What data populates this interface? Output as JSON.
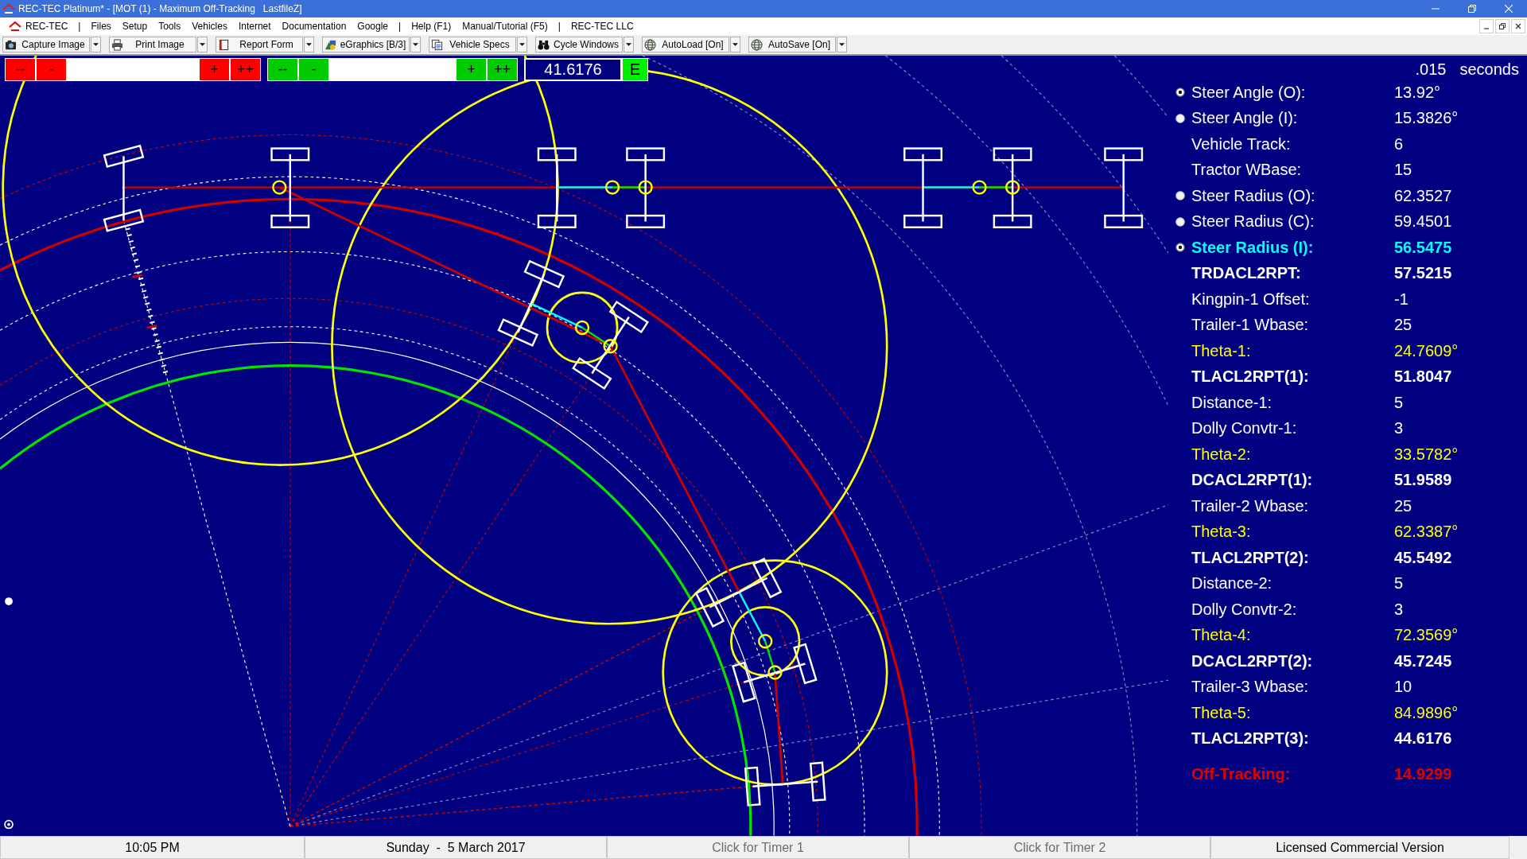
{
  "window": {
    "title": "REC-TEC Platinum* - [MOT (1) - Maximum Off-Tracking   LastfileZ]"
  },
  "menu": [
    {
      "label": "REC-TEC",
      "kind": "app"
    },
    {
      "label": "|",
      "kind": "separator"
    },
    {
      "label": "Files",
      "kind": "item"
    },
    {
      "label": "Setup",
      "kind": "item"
    },
    {
      "label": "Tools",
      "kind": "item"
    },
    {
      "label": "Vehicles",
      "kind": "item"
    },
    {
      "label": "Internet",
      "kind": "item"
    },
    {
      "label": "Documentation",
      "kind": "item"
    },
    {
      "label": "Google",
      "kind": "item"
    },
    {
      "label": "|",
      "kind": "separator"
    },
    {
      "label": "Help (F1)",
      "kind": "item"
    },
    {
      "label": "Manual/Tutorial (F5)",
      "kind": "item"
    },
    {
      "label": "|",
      "kind": "separator"
    },
    {
      "label": "REC-TEC LLC",
      "kind": "item"
    }
  ],
  "toolbar": [
    {
      "label": "Capture Image",
      "kind": "camera"
    },
    {
      "label": "Print Image",
      "kind": "printer"
    },
    {
      "label": "Report Form",
      "kind": "document"
    },
    {
      "label": "eGraphics [B/3]",
      "kind": "graphics"
    },
    {
      "label": "Vehicle Specs",
      "kind": "copy"
    },
    {
      "label": "Cycle Windows",
      "kind": "binoculars"
    },
    {
      "label": "AutoLoad [On]",
      "kind": "globe"
    },
    {
      "label": "AutoSave [On]",
      "kind": "globe"
    }
  ],
  "steppers": [
    {
      "color": "#ff0000",
      "decrease": [
        "--",
        "-"
      ],
      "increase": [
        "+",
        "++"
      ]
    },
    {
      "color": "#00cc00",
      "decrease": [
        "--",
        "-"
      ],
      "increase": [
        "+",
        "++"
      ]
    }
  ],
  "readout": {
    "value": "41.6176",
    "button": "E"
  },
  "time_step": {
    "value": ".015",
    "unit": "seconds"
  },
  "results": [
    {
      "label": "Steer Angle (O):",
      "value": "13.92°",
      "kind": "option",
      "selected": true,
      "color": "#ffffff",
      "bold": false
    },
    {
      "label": "Steer Angle (I):",
      "value": "15.3826°",
      "kind": "option",
      "selected": false,
      "color": "#ffffff",
      "bold": false
    },
    {
      "label": "Vehicle Track:",
      "value": "6",
      "kind": "value",
      "color": "#ffffff",
      "bold": false
    },
    {
      "label": "Tractor WBase:",
      "value": "15",
      "kind": "value",
      "color": "#ffffff",
      "bold": false
    },
    {
      "label": "Steer Radius (O):",
      "value": "62.3527",
      "kind": "option",
      "selected": false,
      "color": "#ffffff",
      "bold": false
    },
    {
      "label": "Steer Radius (C):",
      "value": "59.4501",
      "kind": "option",
      "selected": false,
      "color": "#ffffff",
      "bold": false
    },
    {
      "label": "Steer Radius (I):",
      "value": "56.5475",
      "kind": "option",
      "selected": true,
      "color": "#00ffff",
      "bold": true
    },
    {
      "label": "TRDACL2RPT:",
      "value": "57.5215",
      "kind": "value",
      "color": "#ffffff",
      "bold": true
    },
    {
      "label": "Kingpin-1 Offset:",
      "value": "-1",
      "kind": "value",
      "color": "#ffffff",
      "bold": false
    },
    {
      "label": "Trailer-1 Wbase:",
      "value": "25",
      "kind": "value",
      "color": "#ffffff",
      "bold": false
    },
    {
      "label": "Theta-1:",
      "value": "24.7609°",
      "kind": "value",
      "color": "#ffff00",
      "bold": false
    },
    {
      "label": "TLACL2RPT(1):",
      "value": "51.8047",
      "kind": "value",
      "color": "#ffffff",
      "bold": true
    },
    {
      "label": "Distance-1:",
      "value": "5",
      "kind": "value",
      "color": "#ffffff",
      "bold": false
    },
    {
      "label": "Dolly Convtr-1:",
      "value": "3",
      "kind": "value",
      "color": "#ffffff",
      "bold": false
    },
    {
      "label": "Theta-2:",
      "value": "33.5782°",
      "kind": "value",
      "color": "#ffff00",
      "bold": false
    },
    {
      "label": "DCACL2RPT(1):",
      "value": "51.9589",
      "kind": "value",
      "color": "#ffffff",
      "bold": true
    },
    {
      "label": "Trailer-2 Wbase:",
      "value": "25",
      "kind": "value",
      "color": "#ffffff",
      "bold": false
    },
    {
      "label": "Theta-3:",
      "value": "62.3387°",
      "kind": "value",
      "color": "#ffff00",
      "bold": false
    },
    {
      "label": "TLACL2RPT(2):",
      "value": "45.5492",
      "kind": "value",
      "color": "#ffffff",
      "bold": true
    },
    {
      "label": "Distance-2:",
      "value": "5",
      "kind": "value",
      "color": "#ffffff",
      "bold": false
    },
    {
      "label": "Dolly Convtr-2:",
      "value": "3",
      "kind": "value",
      "color": "#ffffff",
      "bold": false
    },
    {
      "label": "Theta-4:",
      "value": "72.3569°",
      "kind": "value",
      "color": "#ffff00",
      "bold": false
    },
    {
      "label": "DCACL2RPT(2):",
      "value": "45.7245",
      "kind": "value",
      "color": "#ffffff",
      "bold": true
    },
    {
      "label": "Trailer-3 Wbase:",
      "value": "10",
      "kind": "value",
      "color": "#ffffff",
      "bold": false
    },
    {
      "label": "Theta-5:",
      "value": "84.9896°",
      "kind": "value",
      "color": "#ffff00",
      "bold": false
    },
    {
      "label": "TLACL2RPT(3):",
      "value": "44.6176",
      "kind": "value",
      "color": "#ffffff",
      "bold": true
    },
    {
      "label": "Off-Tracking:",
      "value": "14.9299",
      "kind": "total",
      "color": "#e00000",
      "bold": true
    }
  ],
  "status_bar": [
    {
      "text": "10:05 PM",
      "kind": "text"
    },
    {
      "text": "Sunday  -  5 March 2017",
      "kind": "text"
    },
    {
      "text": "Click for Timer 1",
      "kind": "timer"
    },
    {
      "text": "Click for Timer 2",
      "kind": "timer"
    },
    {
      "text": "Licensed Commercial Version",
      "kind": "text"
    }
  ]
}
